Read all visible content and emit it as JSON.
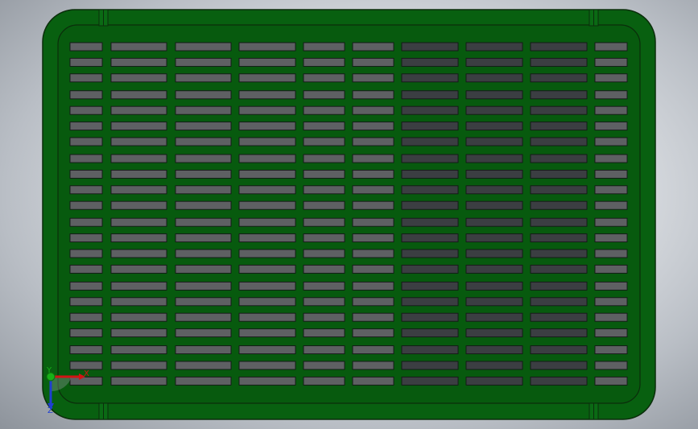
{
  "viewport": {
    "background": "#dfe2e6",
    "part": {
      "name": "vented-grille-panel",
      "body_color": "#086010",
      "edge_color": "#0b2d0b",
      "slot_color": "#5e6063",
      "slot_shade_color": "#3b3e42",
      "slot_columns": 10,
      "slot_rows": 22
    },
    "triad": {
      "x_label": "X",
      "y_label": "Y",
      "z_label": "Z",
      "x_color": "#d21414",
      "y_color": "#18b018",
      "z_color": "#1f3fd2"
    }
  }
}
